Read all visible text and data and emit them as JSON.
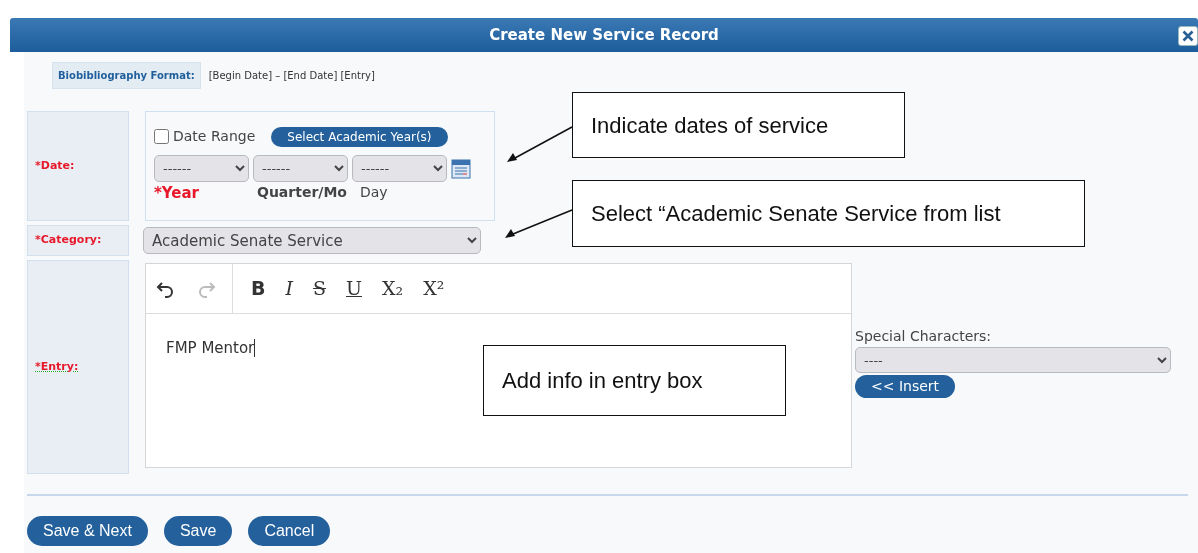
{
  "dialog": {
    "title": "Create New Service Record"
  },
  "format": {
    "label": "Biobibliography Format:",
    "value": "[Begin Date] – [End Date] [Entry]"
  },
  "date": {
    "label": "*Date:",
    "date_range": {
      "label": "Date Range",
      "checked": false
    },
    "academic_year_button": "Select Academic Year(s)",
    "selects": [
      {
        "value": "------",
        "caption": "*Year",
        "required": true
      },
      {
        "value": "------",
        "caption": "Quarter/Mo",
        "required": false
      },
      {
        "value": "------",
        "caption": "Day",
        "required": false
      }
    ]
  },
  "category": {
    "label": "*Category:",
    "value": "Academic Senate Service"
  },
  "entry": {
    "label": "*Entry:",
    "value": "FMP Mentor",
    "toolbar": [
      {
        "kind": "undo",
        "disabled": false
      },
      {
        "kind": "redo",
        "disabled": true
      },
      {
        "kind": "bold",
        "label": "B"
      },
      {
        "kind": "italic",
        "label": "I"
      },
      {
        "kind": "strike",
        "label": "S"
      },
      {
        "kind": "underline",
        "label": "U"
      },
      {
        "kind": "subscript",
        "label": "X₂"
      },
      {
        "kind": "superscript",
        "label": "X²"
      }
    ]
  },
  "special_characters": {
    "label": "Special Characters:",
    "value": "----",
    "button": "<< Insert"
  },
  "footer_buttons": [
    "Save & Next",
    "Save",
    "Cancel"
  ],
  "callouts": [
    "Indicate dates of service",
    "Select “Academic Senate Service from list",
    "Add info in entry box"
  ]
}
